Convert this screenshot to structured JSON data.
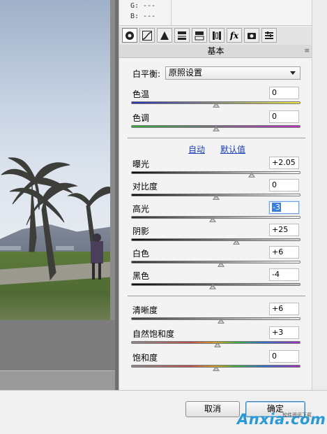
{
  "readout": {
    "g": "G:  ---",
    "b": "B:  ---"
  },
  "panel": {
    "section_title": "基本",
    "menu_icon": "≡",
    "white_balance": {
      "label": "白平衡:",
      "value": "原照设置"
    },
    "controls": [
      {
        "name": "temperature",
        "label": "色温",
        "value": "0",
        "level": 0.5,
        "gradient": [
          "#2b2fb8",
          "#e8e840"
        ]
      },
      {
        "name": "tint",
        "label": "色调",
        "value": "0",
        "level": 0.5,
        "gradient": [
          "#2fae3a",
          "#c02cc4"
        ]
      },
      {
        "name": "exposure",
        "label": "曝光",
        "value": "+2.05",
        "level": 0.71,
        "gradient": [
          "#0a0a0a",
          "#ffffff"
        ]
      },
      {
        "name": "contrast",
        "label": "对比度",
        "value": "0",
        "level": 0.5,
        "gradient": [
          "#0a0a0a",
          "#ffffff"
        ]
      },
      {
        "name": "highlights",
        "label": "高光",
        "value": "-3",
        "level": 0.48,
        "gradient": [
          "#2a2a2a",
          "#ffffff"
        ]
      },
      {
        "name": "shadows",
        "label": "阴影",
        "value": "+25",
        "level": 0.62,
        "gradient": [
          "#0a0a0a",
          "#d8d8d8"
        ]
      },
      {
        "name": "whites",
        "label": "白色",
        "value": "+6",
        "level": 0.53,
        "gradient": [
          "#2a2a2a",
          "#ffffff"
        ]
      },
      {
        "name": "blacks",
        "label": "黑色",
        "value": "-4",
        "level": 0.48,
        "gradient": [
          "#0a0a0a",
          "#bcbcbc"
        ]
      },
      {
        "name": "clarity",
        "label": "清晰度",
        "value": "+6",
        "level": 0.53,
        "gradient": [
          "#3a3a3a",
          "#f0f0f0"
        ]
      },
      {
        "name": "vibrance",
        "label": "自然饱和度",
        "value": "+3",
        "level": 0.51,
        "gradient": [
          "#888888",
          "#d02020"
        ]
      },
      {
        "name": "saturation",
        "label": "饱和度",
        "value": "0",
        "level": 0.5,
        "gradient": [
          "#888888",
          "#2020d0"
        ]
      }
    ],
    "auto_label": "自动",
    "default_label": "默认值"
  },
  "toolbar": {
    "tools": [
      {
        "icon": "aperture-icon",
        "active": true
      },
      {
        "icon": "tone-curve-icon"
      },
      {
        "icon": "detail-triangle-icon"
      },
      {
        "icon": "hsl-icon"
      },
      {
        "icon": "split-toning-icon"
      },
      {
        "icon": "lens-correction-icon"
      },
      {
        "icon": "fx-icon",
        "text": "fx"
      },
      {
        "icon": "camera-calibration-icon"
      },
      {
        "icon": "presets-icon"
      }
    ]
  },
  "buttons": {
    "cancel": "取消",
    "ok": "确定"
  },
  "watermark": {
    "text": "Anxia.com",
    "sub": "软件资讯下载"
  },
  "colors": {
    "link": "#1a3fb4",
    "selection": "#3b7fd6"
  }
}
